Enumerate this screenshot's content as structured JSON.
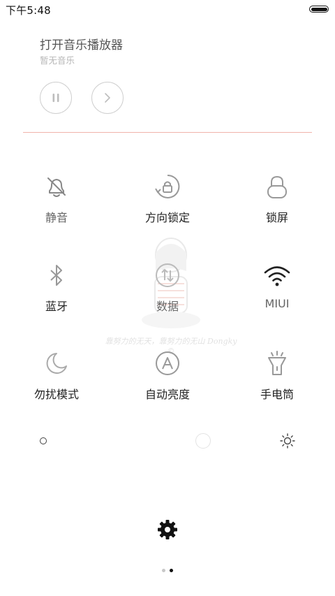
{
  "status_bar": {
    "time": "下午5:48",
    "battery_level": 1.0
  },
  "music": {
    "title": "打开音乐播放器",
    "subtitle": "暂无音乐"
  },
  "toggles": [
    {
      "label": "静音",
      "icon": "bell-off-icon"
    },
    {
      "label": "方向锁定",
      "icon": "rotation-lock-icon"
    },
    {
      "label": "锁屏",
      "icon": "lock-icon"
    },
    {
      "label": "蓝牙",
      "icon": "bluetooth-icon"
    },
    {
      "label": "数据",
      "icon": "mobile-data-icon"
    },
    {
      "label": "MIUI",
      "icon": "wifi-icon"
    },
    {
      "label": "勿扰模式",
      "icon": "moon-icon"
    },
    {
      "label": "自动亮度",
      "icon": "auto-brightness-icon"
    },
    {
      "label": "手电筒",
      "icon": "flashlight-icon"
    }
  ],
  "watermark": {
    "text": "靠努力的无天，靠努力的无山 Dongky ©"
  },
  "brightness": {
    "level": 0.67
  },
  "pager": {
    "current": 2,
    "total": 2
  },
  "colors": {
    "divider": "#f0b3ab",
    "icon_gray": "#9a9a9a",
    "icon_active": "#222222"
  }
}
